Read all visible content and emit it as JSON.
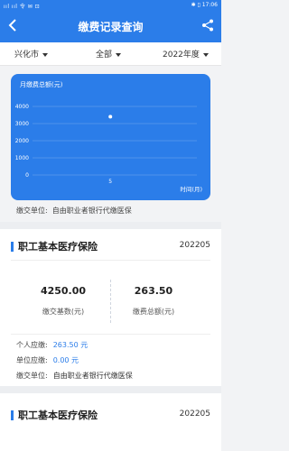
{
  "statusbar": {
    "signal": "ııl ııl 令 ✉ ⊡",
    "right": "✱ ▯ 17:06"
  },
  "header": {
    "title": "缴费记录查询"
  },
  "filters": [
    {
      "label": "兴化市"
    },
    {
      "label": "全部"
    },
    {
      "label": "2022年度"
    }
  ],
  "chart_data": {
    "type": "scatter",
    "title": "",
    "subtitle": "月缴费总额(元)",
    "ylabel": "",
    "xlabel": "时间(月)",
    "ylim": [
      0,
      4000
    ],
    "yticks": [
      "0",
      "1000",
      "2000",
      "3000",
      "4000"
    ],
    "xticks": [
      "5"
    ],
    "points": [
      {
        "x": 5,
        "y": 3400
      }
    ],
    "grid": true,
    "accent": "#2b7de9"
  },
  "chart_unit": {
    "label": "缴交单位:",
    "value": "自由职业者银行代缴医保"
  },
  "records": [
    {
      "title": "职工基本医疗保险",
      "period": "202205",
      "base_value": "4250.00",
      "base_label": "缴交基数(元)",
      "total_value": "263.50",
      "total_label": "缴费总额(元)",
      "personal_label": "个人应缴:",
      "personal_value": "263.50 元",
      "unit_label": "单位应缴:",
      "unit_value": "0.00 元",
      "org_label": "缴交单位:",
      "org_value": "自由职业者银行代缴医保"
    },
    {
      "title": "职工基本医疗保险",
      "period": "202205"
    }
  ]
}
